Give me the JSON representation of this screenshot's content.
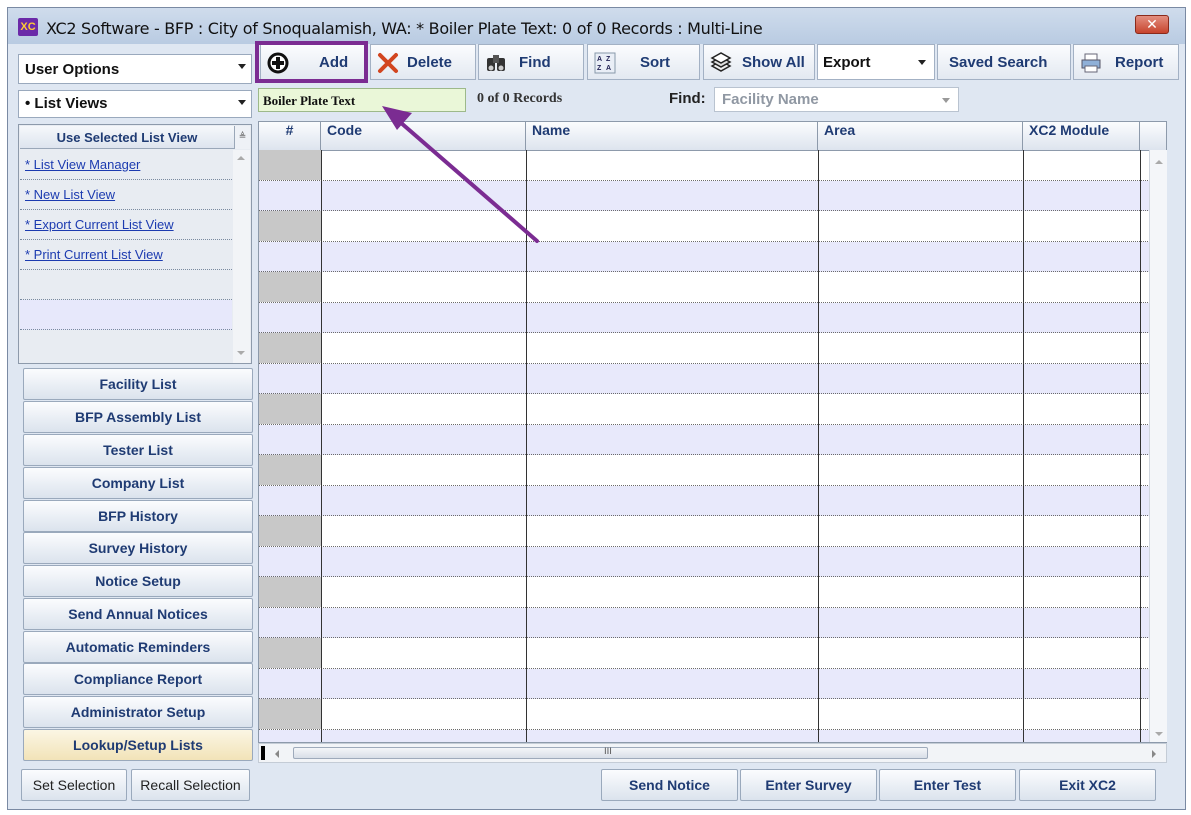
{
  "window": {
    "title": "XC2 Software - BFP : City of Snoqualamish, WA: * Boiler Plate Text: 0 of 0 Records : Multi-Line",
    "close_label": "✕",
    "app_icon_text": "XC"
  },
  "user_options": {
    "label": "User Options"
  },
  "list_views": {
    "label": "List Views"
  },
  "toolbar": {
    "add": "Add",
    "delete": "Delete",
    "find": "Find",
    "sort": "Sort",
    "show_all": "Show All",
    "export": "Export",
    "saved_search": "Saved Search",
    "report": "Report"
  },
  "record": {
    "type": "Boiler Plate Text",
    "count": "0 of 0 Records",
    "find_label": "Find:",
    "find_value": "Facility Name"
  },
  "list_view_panel": {
    "header": "Use Selected List View",
    "items": [
      "* List View Manager",
      "* New List View",
      "* Export Current List View",
      "* Print Current List View"
    ]
  },
  "nav": [
    "Facility List",
    "BFP Assembly List",
    "Tester List",
    "Company List",
    "BFP History",
    "Survey History",
    "Notice Setup",
    "Send Annual Notices",
    "Automatic Reminders",
    "Compliance Report",
    "Administrator Setup",
    "Lookup/Setup Lists"
  ],
  "grid": {
    "columns": [
      "#",
      "Code",
      "Name",
      "Area",
      "XC2 Module"
    ]
  },
  "bottom": {
    "set_selection": "Set Selection",
    "recall_selection": "Recall Selection",
    "send_notice": "Send Notice",
    "enter_survey": "Enter Survey",
    "enter_test": "Enter Test",
    "exit": "Exit XC2"
  },
  "colors": {
    "highlight": "#7b2c92",
    "link": "#1c3bb0",
    "row_alt": "#e8e9fb"
  }
}
